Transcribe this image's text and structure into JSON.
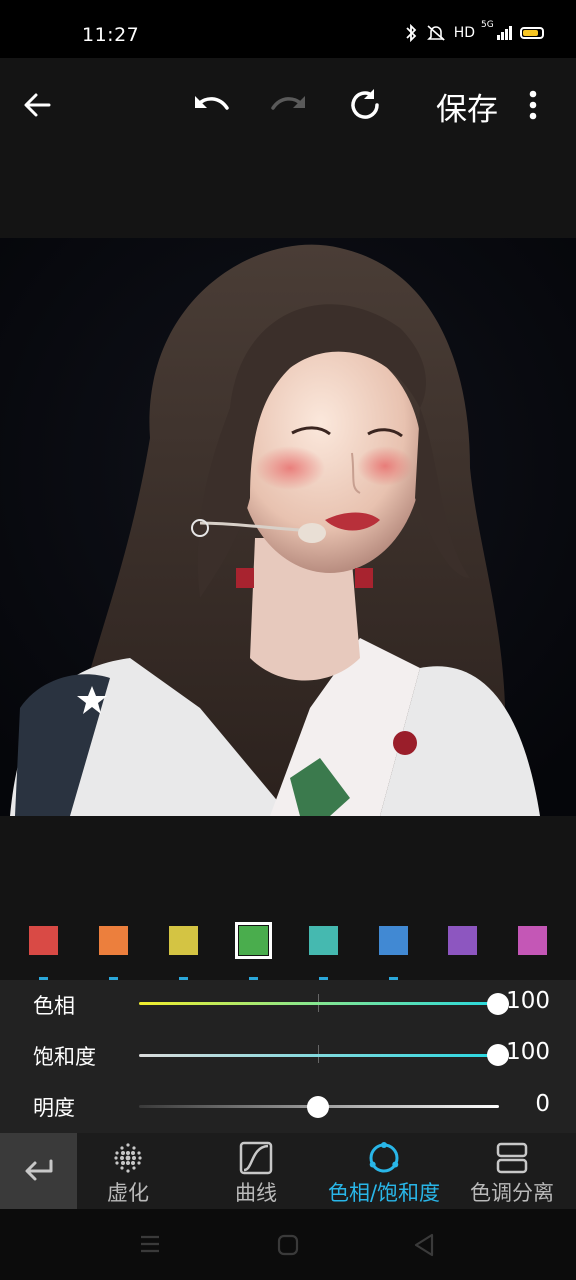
{
  "status_bar": {
    "time": "11:27",
    "network_label": "HD",
    "signal_label": "5G",
    "battery_color": "#f7c623"
  },
  "toolbar": {
    "back_icon": "arrow-left-icon",
    "undo_icon": "undo-icon",
    "redo_icon": "redo-icon",
    "reset_icon": "reset-icon",
    "save_label": "保存",
    "more_icon": "more-vertical-icon"
  },
  "swatches": [
    {
      "color": "#d94a45",
      "selected": false
    },
    {
      "color": "#ec7f3d",
      "selected": false
    },
    {
      "color": "#d4c443",
      "selected": false
    },
    {
      "color": "#4aad4d",
      "selected": true
    },
    {
      "color": "#45b9b0",
      "selected": false
    },
    {
      "color": "#4189d3",
      "selected": false
    },
    {
      "color": "#8d56c0",
      "selected": false
    },
    {
      "color": "#c457b6",
      "selected": false
    }
  ],
  "adjustments": {
    "hue": {
      "label": "色相",
      "value": "100"
    },
    "saturation": {
      "label": "饱和度",
      "value": "100"
    },
    "brightness": {
      "label": "明度",
      "value": "0"
    }
  },
  "tabs": [
    {
      "label": "虚化",
      "icon": "blur-icon",
      "active": false
    },
    {
      "label": "曲线",
      "icon": "curve-icon",
      "active": false
    },
    {
      "label": "色相/饱和度",
      "icon": "hue-saturation-icon",
      "active": true
    },
    {
      "label": "色调分离",
      "icon": "split-tone-icon",
      "active": false
    }
  ],
  "accent_color": "#29b6e8"
}
